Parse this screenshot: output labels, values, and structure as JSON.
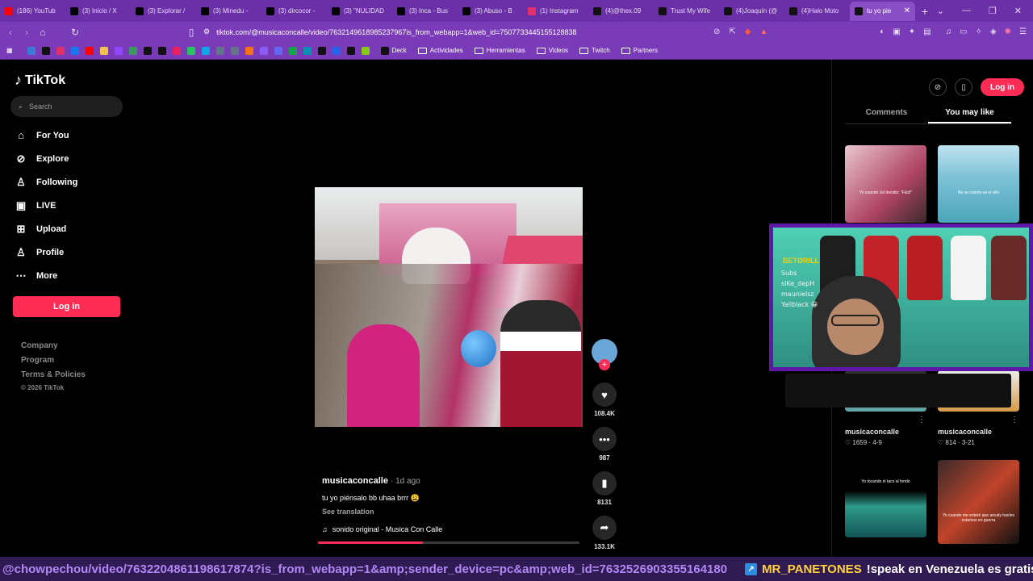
{
  "browser": {
    "tabs": [
      {
        "label": "(186) YouTub",
        "color": "#ff0000"
      },
      {
        "label": "(3) Inicio / X",
        "color": "#000000"
      },
      {
        "label": "(3) Explorar /",
        "color": "#000000"
      },
      {
        "label": "(3) Minedu -",
        "color": "#000000"
      },
      {
        "label": "(3) dircocor -",
        "color": "#000000"
      },
      {
        "label": "(3) \"NULIDAD",
        "color": "#000000"
      },
      {
        "label": "(3) Inca - Bus",
        "color": "#000000"
      },
      {
        "label": "(3) Abuso - B",
        "color": "#000000"
      },
      {
        "label": "(1) Instagram",
        "color": "#e1306c"
      },
      {
        "label": "(4)@thex.09",
        "color": "#111111"
      },
      {
        "label": "Trust My Wife",
        "color": "#111111"
      },
      {
        "label": "(4)Joaquín (@",
        "color": "#111111"
      },
      {
        "label": "(4)Halo Moto",
        "color": "#111111"
      },
      {
        "label": "tu yo pie",
        "color": "#111111"
      }
    ],
    "new_tab": "+",
    "url": "tiktok.com/@musicaconcalle/video/7632149618985237967is_from_webapp=1&web_id=7507733445155128838",
    "bookmarks": [
      "Deck",
      "Actividades",
      "Herramientas",
      "Videos",
      "Twitch",
      "Partners"
    ]
  },
  "tiktok": {
    "logo": "TikTok",
    "search_placeholder": "Search",
    "nav": [
      {
        "label": "For You",
        "icon": "home-icon"
      },
      {
        "label": "Explore",
        "icon": "compass-icon"
      },
      {
        "label": "Following",
        "icon": "following-icon"
      },
      {
        "label": "LIVE",
        "icon": "live-icon"
      },
      {
        "label": "Upload",
        "icon": "upload-icon"
      },
      {
        "label": "Profile",
        "icon": "profile-icon"
      },
      {
        "label": "More",
        "icon": "more-icon"
      }
    ],
    "login": "Log in",
    "footer": {
      "company": "Company",
      "program": "Program",
      "terms": "Terms & Policies",
      "copyright": "© 2026 TikTok"
    },
    "video": {
      "author": "musicaconcalle",
      "ago": "· 1d ago",
      "description": "tu yo piénsalo bb uhaa brrr 😩",
      "see_translation": "See translation",
      "music": "sonido original - Musica Con Calle",
      "progress": 0.4
    },
    "actions": {
      "likes": "108.4K",
      "comments": "987",
      "saves": "8131",
      "shares": "133.1K"
    },
    "right": {
      "login": "Log in",
      "tab_comments": "Comments",
      "tab_like": "You may like",
      "thumb_captions": [
        "Yo cuando Ud decidio: \"Fácil\"",
        "No se cuanto es el año",
        "",
        "",
        "Yo tocando el taco al fondo",
        "Yo cuando me enteré que ancaly hacíes estamos en guerra"
      ],
      "cards": [
        {
          "user": "musicaconcalle",
          "stats": "♡ 1659 · 4-9"
        },
        {
          "user": "musicaconcalle",
          "stats": "♡ 814 · 3-21"
        }
      ]
    }
  },
  "overlay": {
    "cam_logo": "BETØRILL",
    "cam_lines": [
      "Subs",
      "siKe_depH",
      "maunielsz",
      "Yallblack 😀"
    ],
    "ticker_link": "@chowpechou/video/7632204861198617874?is_from_webapp=1&amp;sender_device=pc&amp;web_id=7632526903355164180",
    "ticker_user": "MR_PANETONES",
    "ticker_msg": "!speak en Venezuela es gratis"
  }
}
